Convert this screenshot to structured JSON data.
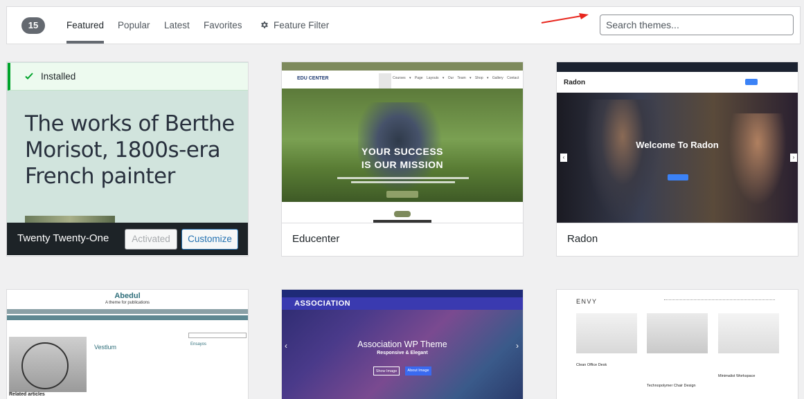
{
  "filter_bar": {
    "count": "15",
    "tabs": [
      {
        "label": "Featured",
        "active": true
      },
      {
        "label": "Popular",
        "active": false
      },
      {
        "label": "Latest",
        "active": false
      },
      {
        "label": "Favorites",
        "active": false
      }
    ],
    "feature_filter_label": "Feature Filter",
    "search_placeholder": "Search themes..."
  },
  "themes": [
    {
      "name": "Twenty Twenty-One",
      "installed_label": "Installed",
      "preview_title": "The works of Berthe Morisot, 1800s-era French painter",
      "activated_label": "Activated",
      "customize_label": "Customize"
    },
    {
      "name": "Educenter",
      "preview_logo": "EDU CENTER",
      "preview_menu": "Courses ▾  Page Layouts ▾  Our Team ▾  Shop ▾  Gallery  Contact",
      "preview_headline": "YOUR SUCCESS IS OUR MISSION"
    },
    {
      "name": "Radon",
      "preview_logo": "Radon",
      "preview_headline": "Welcome To Radon"
    },
    {
      "name": "Abedul",
      "preview_title": "Abedul",
      "preview_tagline": "A theme for publications",
      "preview_post_title": "Vestlum",
      "preview_related": "Related articles",
      "preview_sidebar": "Ensayos"
    },
    {
      "name": "Association",
      "preview_logo": "ASSOCIATION",
      "preview_headline": "Association WP Theme",
      "preview_subhead": "Responsive & Elegant",
      "preview_btn1": "Show Image",
      "preview_btn2": "About Image"
    },
    {
      "name": "Envy",
      "preview_logo": "ENVY",
      "preview_posts": [
        "Clean Office Desk",
        "Technopolymer Chair Design",
        "Minimalist Workspace"
      ]
    }
  ],
  "colors": {
    "accent": "#2271b1",
    "installed_border": "#00a32a",
    "arrow": "#e8261d"
  }
}
